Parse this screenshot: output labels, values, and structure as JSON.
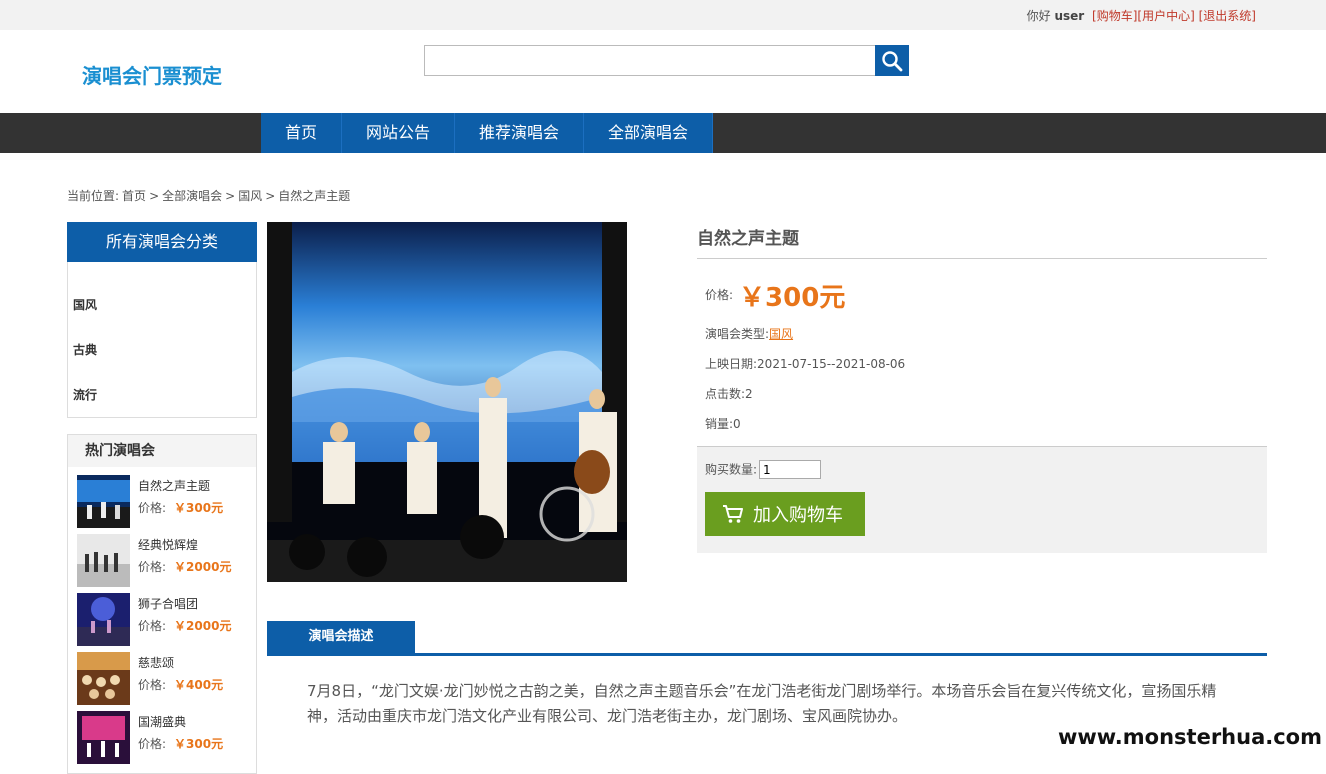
{
  "topbar": {
    "greeting": "你好",
    "user": "user",
    "cart": "[购物车]",
    "center": "[用户中心]",
    "logout": "[退出系统]"
  },
  "header": {
    "logo": "演唱会门票预定",
    "search_placeholder": "",
    "search_icon": "search-icon"
  },
  "nav": {
    "items": [
      "首页",
      "网站公告",
      "推荐演唱会",
      "全部演唱会"
    ]
  },
  "breadcrumb": {
    "prefix": "当前位置:",
    "items": [
      "首页",
      "全部演唱会",
      "国风",
      "自然之声主题"
    ],
    "separator": ">"
  },
  "sidebar": {
    "categories_title": "所有演唱会分类",
    "categories": [
      "国风",
      "古典",
      "流行"
    ],
    "hot_title": "热门演唱会",
    "price_label": "价格:",
    "hot_items": [
      {
        "name": "自然之声主题",
        "price": "￥300元"
      },
      {
        "name": "经典悦辉煌",
        "price": "￥2000元"
      },
      {
        "name": "狮子合唱团",
        "price": "￥2000元"
      },
      {
        "name": "慈悲颂",
        "price": "￥400元"
      },
      {
        "name": "国潮盛典",
        "price": "￥300元"
      }
    ]
  },
  "product": {
    "title": "自然之声主题",
    "price_label": "价格:",
    "price": "￥300元",
    "type_label": "演唱会类型:",
    "type": "国风",
    "date_label": "上映日期:",
    "date": "2021-07-15--2021-08-06",
    "clicks_label": "点击数:",
    "clicks": "2",
    "sales_label": "销量:",
    "sales": "0",
    "qty_label": "购买数量:",
    "qty": "1",
    "add_cart": "加入购物车"
  },
  "description": {
    "tab": "演唱会描述",
    "text": "7月8日，“龙门文娱·龙门妙悦之古韵之美，自然之声主题音乐会”在龙门浩老街龙门剧场举行。本场音乐会旨在复兴传统文化，宣扬国乐精神，活动由重庆市龙门浩文化产业有限公司、龙门浩老街主办，龙门剧场、宝风画院协办。"
  },
  "watermark": "www.monsterhua.com",
  "colors": {
    "accent": "#0d5ea8",
    "price": "#e8751a",
    "cart_button": "#6a9e1f",
    "nav_bg": "#333333"
  }
}
